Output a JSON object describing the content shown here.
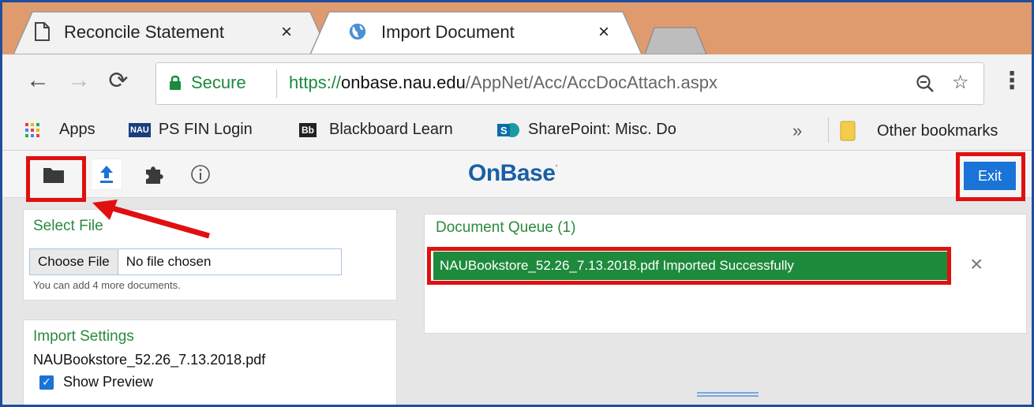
{
  "tabs": [
    {
      "label": "Reconcile Statement",
      "icon": "page-icon",
      "close": "×"
    },
    {
      "label": "Import Document",
      "icon": "globe-icon",
      "close": "×"
    }
  ],
  "omnibox": {
    "secure_label": "Secure",
    "url_protocol": "https://",
    "url_host": "onbase.nau.edu",
    "url_path": "/AppNet/Acc/AccDocAttach.aspx"
  },
  "bookmarks": {
    "apps": "Apps",
    "ps_fin": "PS FIN Login",
    "blackboard": "Blackboard Learn",
    "sharepoint": "SharePoint: Misc. Do",
    "overflow": "»",
    "other": "Other bookmarks"
  },
  "app": {
    "logo": "OnBase",
    "logo_mark": "·",
    "exit_label": "Exit",
    "select_file": {
      "title": "Select File",
      "choose_button": "Choose File",
      "no_file": "No file chosen",
      "note": "You can add 4 more documents."
    },
    "import_settings": {
      "title": "Import Settings",
      "filename": "NAUBookstore_52.26_7.13.2018.pdf",
      "show_preview": "Show Preview"
    },
    "queue": {
      "title": "Document Queue (1)",
      "item": "NAUBookstore_52.26_7.13.2018.pdf   Imported Successfully",
      "close": "×"
    }
  },
  "colors": {
    "tabstrip": "#df9b6e",
    "accent_green": "#1e8a3c",
    "exit_blue": "#1a73d6",
    "highlight_red": "#e01010"
  }
}
